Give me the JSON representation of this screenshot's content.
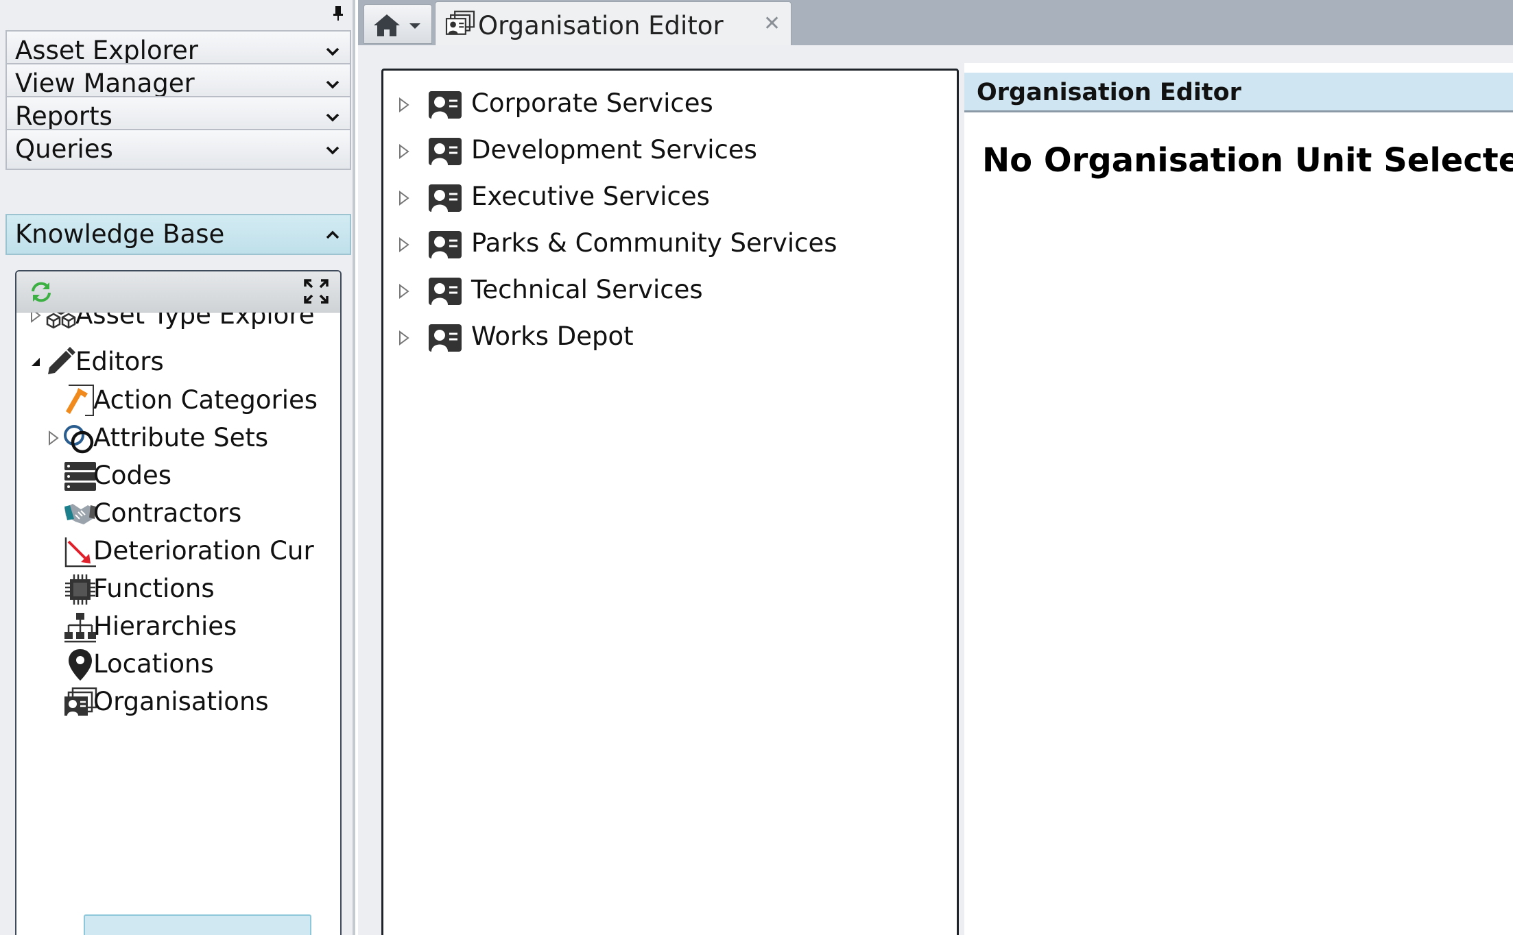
{
  "sidebar": {
    "accordion": [
      {
        "label": "Asset Explorer",
        "expanded": false
      },
      {
        "label": "View Manager",
        "expanded": false
      },
      {
        "label": "Reports",
        "expanded": false
      },
      {
        "label": "Queries",
        "expanded": false
      },
      {
        "label": "Knowledge Base",
        "expanded": true
      }
    ],
    "knowledge_base": {
      "tree": [
        {
          "label": "Asset Type Explore",
          "icon": "cubes-icon",
          "expander": "collapsed"
        },
        {
          "label": "Editors",
          "icon": "pencil-icon",
          "expander": "expanded"
        },
        {
          "label": "Action Categories",
          "icon": "hammer-icon"
        },
        {
          "label": "Attribute Sets",
          "icon": "rings-icon",
          "expander": "collapsed"
        },
        {
          "label": "Codes",
          "icon": "server-icon"
        },
        {
          "label": "Contractors",
          "icon": "handshake-icon"
        },
        {
          "label": "Deterioration Cur",
          "icon": "downtrend-icon"
        },
        {
          "label": "Functions",
          "icon": "chip-icon"
        },
        {
          "label": "Hierarchies",
          "icon": "sitemap-icon"
        },
        {
          "label": "Locations",
          "icon": "map-pin-icon"
        },
        {
          "label": "Organisations",
          "icon": "org-card-icon",
          "selected": true
        }
      ]
    }
  },
  "tabs": [
    {
      "label": "Organisation Editor",
      "active": true
    }
  ],
  "org_tree": [
    {
      "label": "Corporate Services"
    },
    {
      "label": "Development Services"
    },
    {
      "label": "Executive Services"
    },
    {
      "label": "Parks & Community Services"
    },
    {
      "label": "Technical Services"
    },
    {
      "label": "Works Depot"
    }
  ],
  "editor": {
    "title": "Organisation Editor",
    "message": "No Organisation Unit Selected"
  },
  "colors": {
    "accent_selected": "#cfe8f2",
    "header_blue": "#cfe5f1",
    "tabbar": "#a9b1bc"
  }
}
